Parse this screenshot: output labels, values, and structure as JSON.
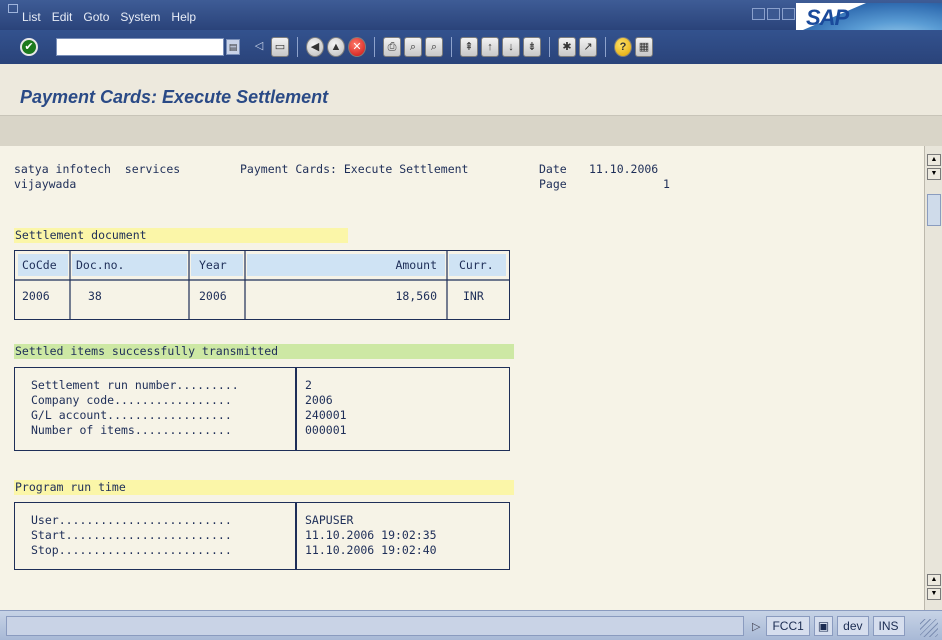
{
  "menubar": {
    "items": [
      "List",
      "Edit",
      "Goto",
      "System",
      "Help"
    ],
    "logo": "SAP"
  },
  "toolbar": {
    "command_value": "",
    "ok_icon": "check-icon"
  },
  "title": "Payment Cards: Execute Settlement",
  "report": {
    "company": "satya infotech  services",
    "heading": "Payment Cards: Execute Settlement",
    "city": "vijaywada",
    "date_label": "Date",
    "date_value": "11.10.2006",
    "page_label": "Page",
    "page_value": "1"
  },
  "settlement_doc": {
    "section_title": "Settlement document",
    "headers": [
      "CoCde",
      "Doc.no.",
      "Year",
      "Amount",
      "Curr."
    ],
    "row": [
      "2006",
      "38",
      "2006",
      "18,560",
      "INR"
    ]
  },
  "settled_items": {
    "section_title": "Settled items successfully transmitted",
    "labels": [
      "Settlement run number.........",
      "Company code.................",
      "G/L account..................",
      "Number of items.............."
    ],
    "values": [
      "2",
      "2006",
      "240001",
      "000001"
    ]
  },
  "run_time": {
    "section_title": "Program run time",
    "labels": [
      "User.........................",
      "Start........................",
      "Stop........................."
    ],
    "values": [
      "SAPUSER",
      "11.10.2006 19:02:35",
      "11.10.2006 19:02:40"
    ]
  },
  "statusbar": {
    "message": "",
    "transaction": "FCC1",
    "system": "dev",
    "mode": "INS"
  }
}
